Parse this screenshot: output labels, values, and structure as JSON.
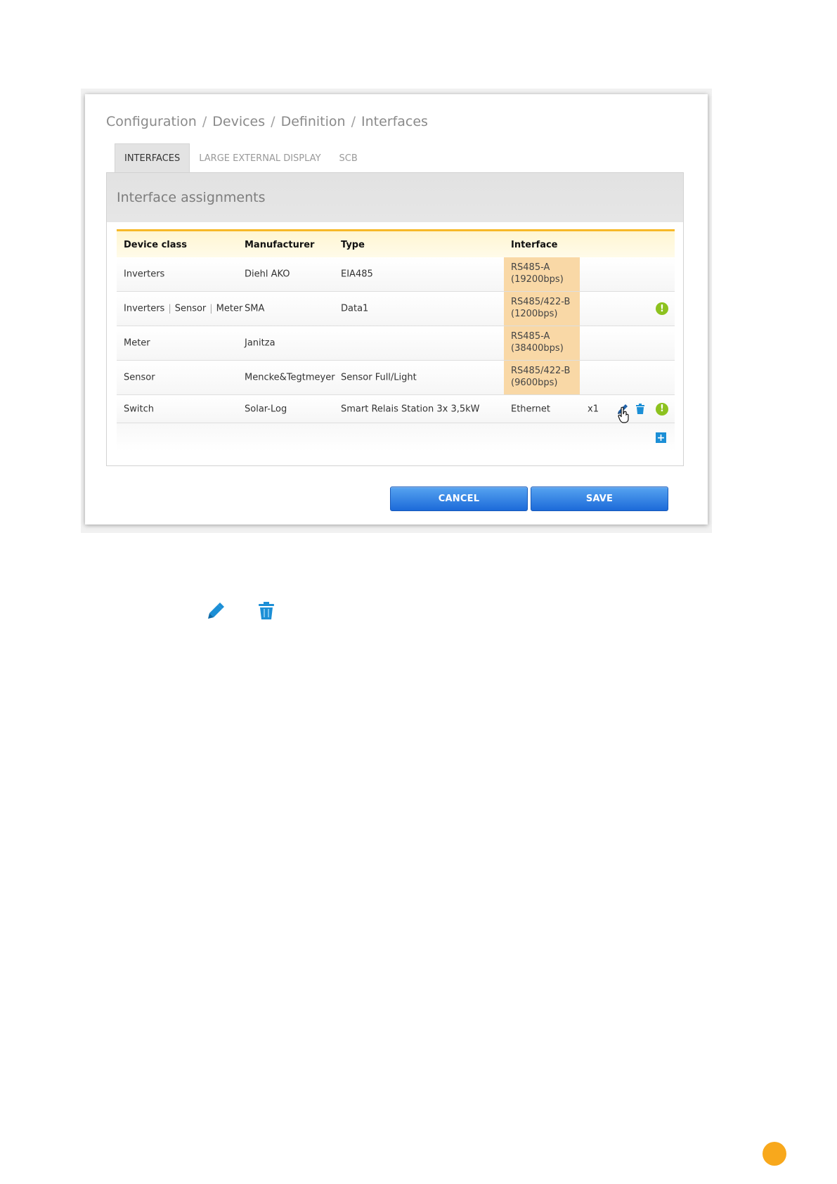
{
  "breadcrumb": [
    "Configuration",
    "Devices",
    "Definition",
    "Interfaces"
  ],
  "breadcrumb_separator": "/",
  "tabs": [
    {
      "label": "INTERFACES",
      "active": true
    },
    {
      "label": "LARGE EXTERNAL DISPLAY",
      "active": false
    },
    {
      "label": "SCB",
      "active": false
    }
  ],
  "section": {
    "title": "Interface assignments"
  },
  "table": {
    "headers": [
      "Device class",
      "Manufacturer",
      "Type",
      "Interface"
    ],
    "rows": [
      {
        "device_class": "Inverters",
        "manufacturer": "Diehl AKO",
        "type": "EIA485",
        "interface_line1": "RS485-A",
        "interface_line2": "(19200bps)"
      },
      {
        "device_class_parts": [
          "Inverters",
          "Sensor",
          "Meter"
        ],
        "manufacturer": "SMA",
        "type": "Data1",
        "interface_line1": "RS485/422-B",
        "interface_line2": "(1200bps)",
        "warning": "!"
      },
      {
        "device_class": "Meter",
        "manufacturer": "Janitza",
        "type": "",
        "interface_line1": "RS485-A",
        "interface_line2": "(38400bps)"
      },
      {
        "device_class": "Sensor",
        "manufacturer": "Mencke&Tegtmeyer",
        "type": "Sensor Full/Light",
        "interface_line1": "RS485/422-B",
        "interface_line2": "(9600bps)"
      },
      {
        "device_class": "Switch",
        "manufacturer": "Solar-Log",
        "type": "Smart Relais Station 3x 3,5kW",
        "interface": "Ethernet",
        "count": "x1",
        "warning": "!"
      }
    ],
    "add_symbol": "+"
  },
  "buttons": {
    "cancel": "CANCEL",
    "save": "SAVE"
  },
  "colors": {
    "accent_orange": "#f7b928",
    "interface_highlight": "#f9d8a6",
    "button_blue": "#1c6ad9",
    "icon_blue": "#1c8fd6",
    "warning_green": "#8dc21f",
    "page_dot": "#f8a81c"
  },
  "icons": {
    "edit": "pencil-icon",
    "delete": "trash-icon",
    "warning": "exclamation-circle-icon",
    "add": "plus-square-icon",
    "cursor": "hand-pointer-cursor"
  }
}
